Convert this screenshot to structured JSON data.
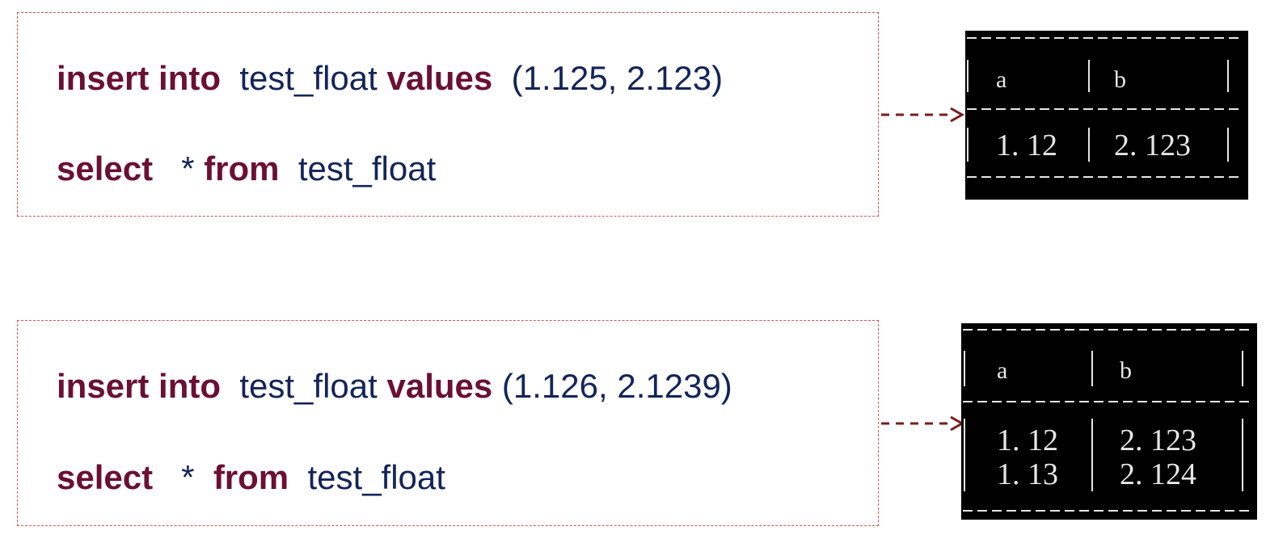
{
  "examples": [
    {
      "insert": {
        "kw1": "insert into",
        "table": "test_float",
        "kw2": "values",
        "args": "(1.125, 2.123)"
      },
      "select": {
        "kw1": "select",
        "star": "*",
        "kw2": "from",
        "table": "test_float"
      },
      "result": {
        "columns": [
          "a",
          "b"
        ],
        "rows": [
          [
            "1. 12",
            "2. 123"
          ]
        ]
      }
    },
    {
      "insert": {
        "kw1": "insert into",
        "table": "test_float",
        "kw2": "values",
        "args": "(1.126, 2.1239)"
      },
      "select": {
        "kw1": "select",
        "star": "*",
        "kw2": "from",
        "table": "test_float"
      },
      "result": {
        "columns": [
          "a",
          "b"
        ],
        "rows": [
          [
            "1. 12",
            "2. 123"
          ],
          [
            "1. 13",
            "2. 124"
          ]
        ]
      }
    }
  ],
  "colors": {
    "keyword": "#6b0f34",
    "identifier": "#13245a",
    "box_border": "#d9534f",
    "arrow": "#7a1c1c",
    "terminal_bg": "#000000",
    "terminal_fg": "#e6e6e6"
  }
}
